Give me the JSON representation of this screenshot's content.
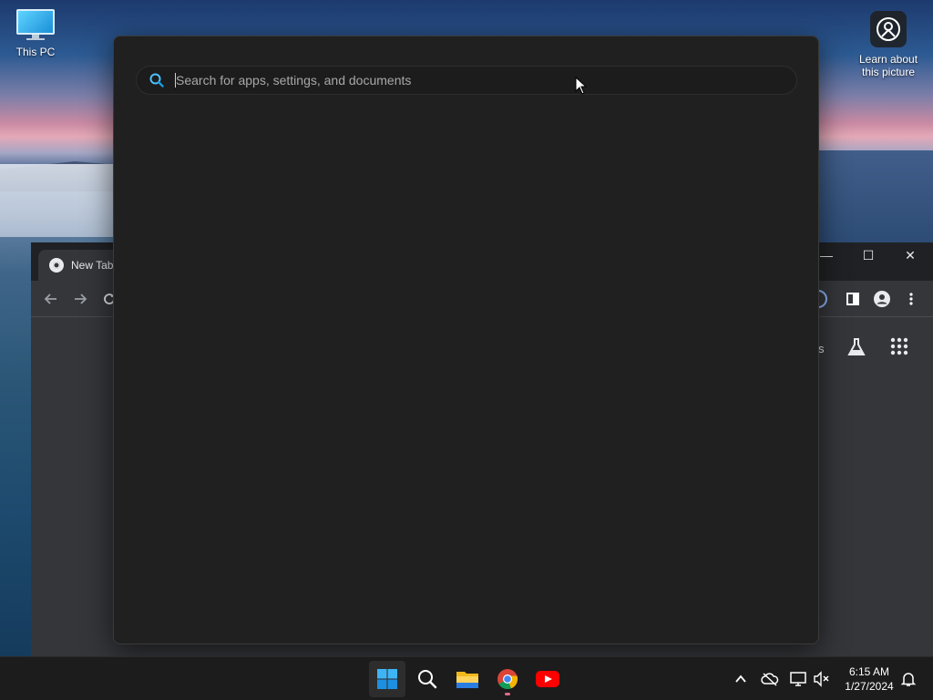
{
  "desktop": {
    "icons": [
      {
        "label": "This PC",
        "icon": "monitor-icon"
      },
      {
        "label": "Learn about\nthis picture",
        "icon": "camera-ring-icon"
      }
    ]
  },
  "browser": {
    "tab_title": "New Tab",
    "partial_shortcut_text": "s",
    "controls": {
      "minimize": "—",
      "maximize": "☐",
      "close": "✕"
    }
  },
  "search": {
    "placeholder": "Search for apps, settings, and documents",
    "value": ""
  },
  "taskbar": {
    "apps": [
      {
        "name": "Start",
        "icon": "windows-logo-icon"
      },
      {
        "name": "Search",
        "icon": "search-icon"
      },
      {
        "name": "File Explorer",
        "icon": "folder-icon"
      },
      {
        "name": "Google Chrome",
        "icon": "chrome-icon"
      },
      {
        "name": "YouTube",
        "icon": "youtube-icon"
      }
    ],
    "clock": {
      "time": "6:15 AM",
      "date": "1/27/2024"
    }
  },
  "colors": {
    "flyout_bg": "#202020",
    "taskbar_bg": "#1c1c1c",
    "accent_blue": "#4cc2ff",
    "youtube_red": "#ff0000"
  }
}
